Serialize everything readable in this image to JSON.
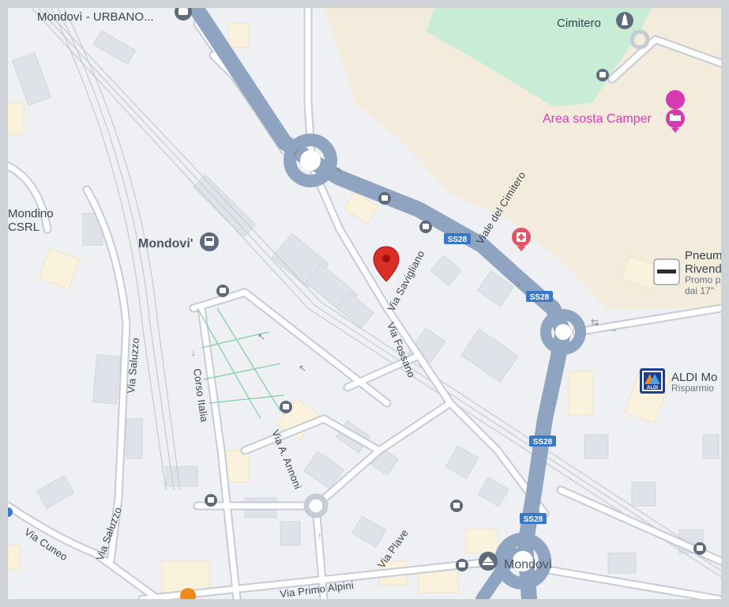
{
  "map": {
    "place_labels": {
      "mondovi_urbano": "Mondovì - URBANO...",
      "cimitero": "Cimitero",
      "area_sosta": "Area sosta Camper",
      "mondino_1": "Mondino",
      "mondino_2": "CSRL",
      "mondovi_station": "Mondovi'",
      "pneu_1": "Pneum",
      "pneu_2": "Rivend",
      "pneu_3": "Promo p",
      "pneu_4": "dai 17\"",
      "aldi_1": "ALDI Mo",
      "aldi_2": "Risparmio",
      "mondovi_bottom": "Mondovì"
    },
    "road_labels": {
      "viale_cimitero": "Viale del Cimitero",
      "via_savigliano": "Via Savigliano",
      "via_fossano": "Via Fossano",
      "via_saluzzo_top": "Via Saluzzo",
      "via_saluzzo_bottom": "Via Saluzzo",
      "corso_italia": "Corso Italia",
      "via_annoni": "Via A. Annoni",
      "via_cuneo": "Via Cuneo",
      "via_plave": "Via Plave",
      "via_primo_alpini": "Via Primo Alpini"
    },
    "shields": [
      "SS28",
      "SS28",
      "SS28",
      "SS28"
    ],
    "aldi_logo": "ALDI",
    "colors": {
      "background": "#eef0f4",
      "main_road": "#8fa4c0",
      "park": "#c8ecd6",
      "sand_area": "#f3ecdd",
      "pin": "#d93025",
      "poi_pink": "#d63ab0",
      "transit_icon": "#5f6b7a"
    }
  }
}
